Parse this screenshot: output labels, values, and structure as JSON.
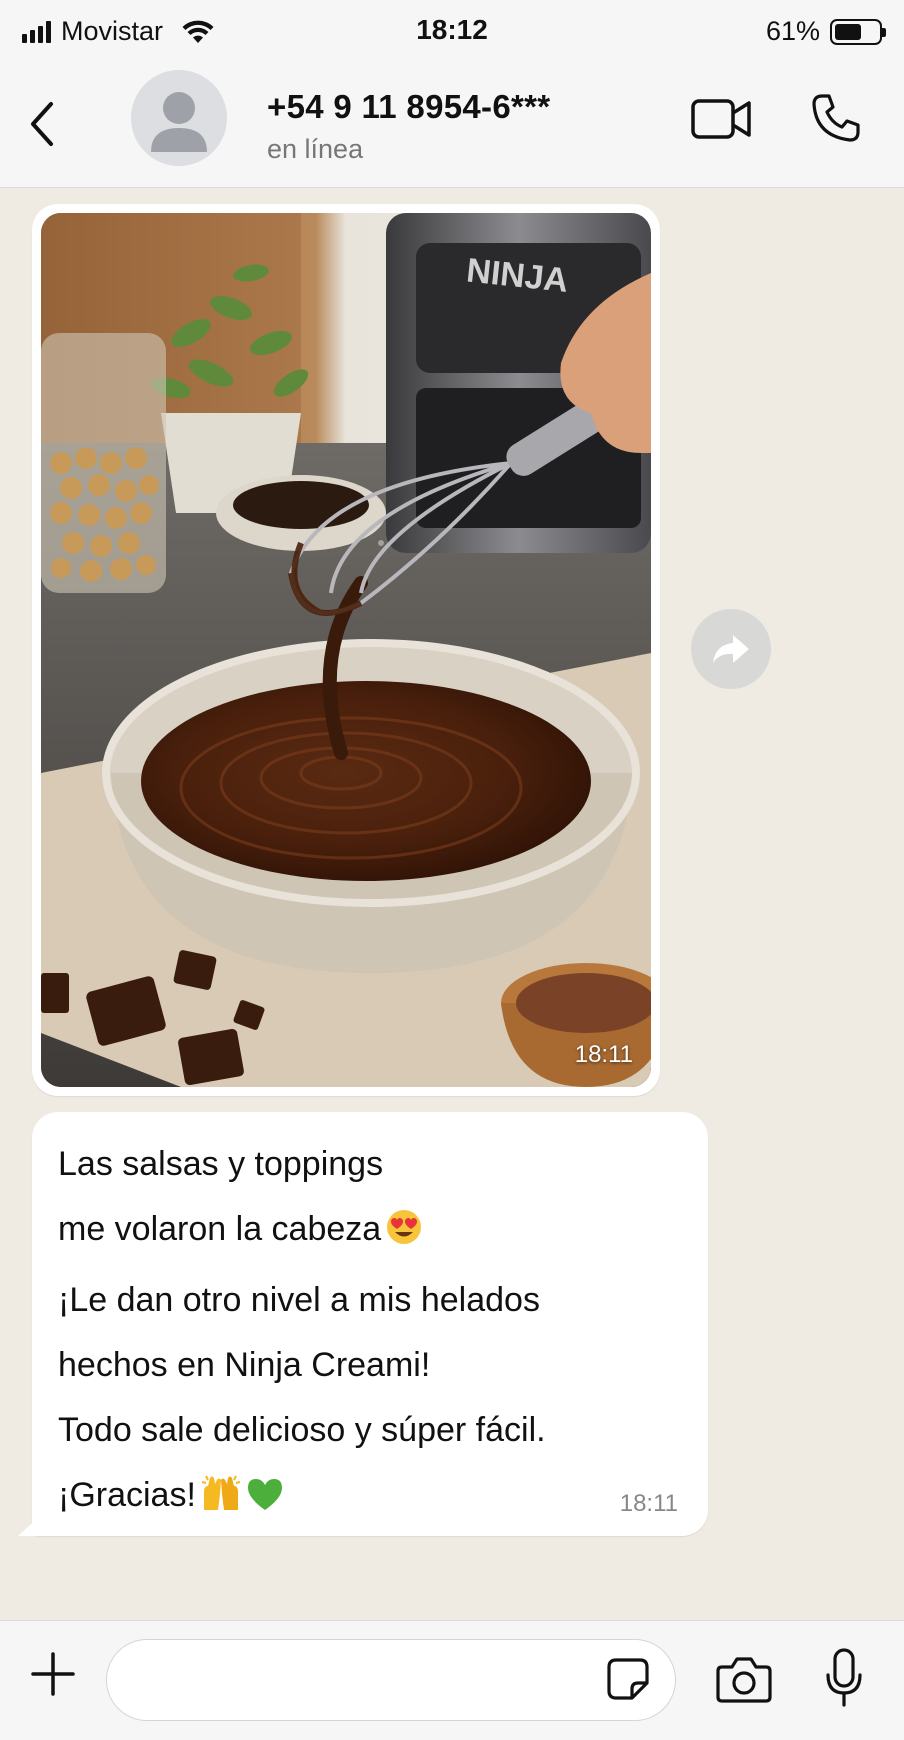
{
  "status_bar": {
    "carrier": "Movistar",
    "time": "18:12",
    "battery_percent": "61%",
    "battery_level": 0.61,
    "icons": [
      "signal-icon",
      "wifi-icon",
      "battery-icon"
    ]
  },
  "header": {
    "contact_name": "+54 9 11 8954-6***",
    "status": "en línea",
    "icons": [
      "back-chevron-icon",
      "avatar-placeholder-icon",
      "video-camera-icon",
      "phone-icon"
    ]
  },
  "messages": [
    {
      "type": "image",
      "photo_brand_text": "NINJA",
      "time": "18:11"
    },
    {
      "type": "text",
      "lines": [
        "Las salsas y toppings",
        "me volaron la cabeza",
        "¡Le dan otro nivel a mis helados",
        "hechos en Ninja Creami!",
        "Todo sale delicioso y súper fácil.",
        "¡Gracias!"
      ],
      "emojis": [
        "heart-eyes-emoji",
        "raised-hands-emoji",
        "green-heart-emoji"
      ],
      "time": "18:11"
    }
  ],
  "input_bar": {
    "placeholder": "",
    "icons": [
      "plus-icon",
      "sticker-icon",
      "camera-icon",
      "microphone-icon"
    ]
  },
  "colors": {
    "chat_background": "#efeae2",
    "bar_background": "#f6f6f6",
    "bubble": "#ffffff"
  }
}
